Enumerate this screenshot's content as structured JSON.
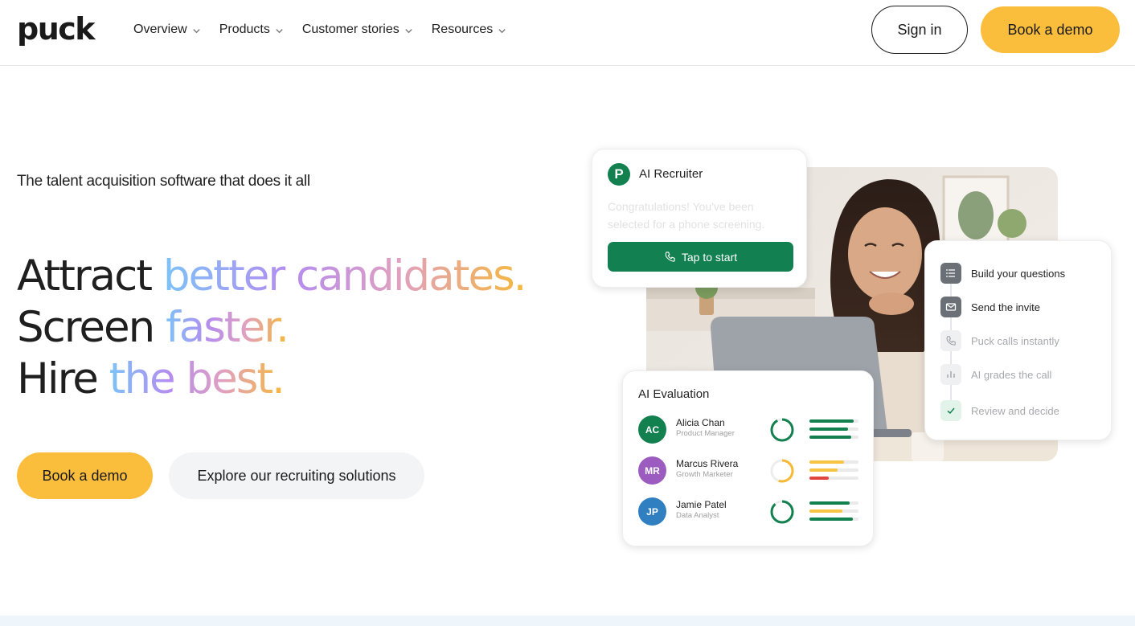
{
  "header": {
    "logo_text": "puck",
    "nav": [
      {
        "label": "Overview"
      },
      {
        "label": "Products"
      },
      {
        "label": "Customer stories"
      },
      {
        "label": "Resources"
      }
    ],
    "sign_in_label": "Sign in",
    "book_demo_label": "Book a demo"
  },
  "hero": {
    "tagline": "The talent acquisition software that does it all",
    "line1_plain": "Attract ",
    "line1_grad": "better candidates.",
    "line2_plain": "Screen ",
    "line2_grad": "faster.",
    "line3_plain": "Hire ",
    "line3_grad": "the best.",
    "book_demo_label": "Book a demo",
    "explore_label": "Explore our recruiting solutions"
  },
  "recruiter_card": {
    "logo_letter": "P",
    "title": "AI Recruiter",
    "message": "Congratulations! You've been selected for a phone screening.",
    "button_label": "Tap to start"
  },
  "steps_card": {
    "steps": [
      {
        "label": "Build your questions",
        "icon": "list-icon",
        "state": "active"
      },
      {
        "label": "Send the invite",
        "icon": "mail-icon",
        "state": "active"
      },
      {
        "label": "Puck calls instantly",
        "icon": "phone-icon",
        "state": "pending"
      },
      {
        "label": "AI grades the call",
        "icon": "bar-chart-icon",
        "state": "pending"
      },
      {
        "label": "Review and decide",
        "icon": "check-icon",
        "state": "pending"
      }
    ]
  },
  "eval_card": {
    "title": "AI Evaluation",
    "candidates": [
      {
        "initials": "AC",
        "name": "Alicia Chan",
        "role": "Product Manager",
        "avatar_color": "#12804f",
        "ring_color": "#12804f",
        "score": 0.92,
        "bars": [
          {
            "value": 0.9,
            "color": "#12804f"
          },
          {
            "value": 0.78,
            "color": "#12804f"
          },
          {
            "value": 0.85,
            "color": "#12804f"
          }
        ]
      },
      {
        "initials": "MR",
        "name": "Marcus Rivera",
        "role": "Growth Marketer",
        "avatar_color": "#9b5bbf",
        "ring_color": "#f7b934",
        "score": 0.55,
        "bars": [
          {
            "value": 0.7,
            "color": "#f7c443"
          },
          {
            "value": 0.58,
            "color": "#f7c443"
          },
          {
            "value": 0.4,
            "color": "#e0463d"
          }
        ]
      },
      {
        "initials": "JP",
        "name": "Jamie Patel",
        "role": "Data Analyst",
        "avatar_color": "#2f7fc1",
        "ring_color": "#12804f",
        "score": 0.88,
        "bars": [
          {
            "value": 0.82,
            "color": "#12804f"
          },
          {
            "value": 0.68,
            "color": "#f7c443"
          },
          {
            "value": 0.88,
            "color": "#12804f"
          }
        ]
      }
    ]
  },
  "colors": {
    "accent_yellow": "#fbbd3c",
    "brand_green": "#12804f"
  }
}
